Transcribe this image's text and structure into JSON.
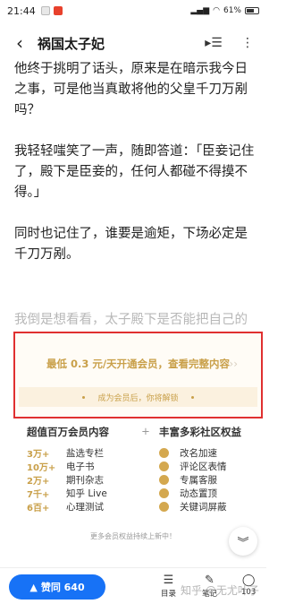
{
  "status_bar": {
    "time": "21:44",
    "battery": "61%"
  },
  "header": {
    "title": "祸国太子妃"
  },
  "article": {
    "paragraphs": [
      "他终于挑明了话头，原来是在暗示我今日之事，可是他当真敢将他的父皇千刀万剐吗？",
      "我轻轻嗤笑了一声，随即答道：「臣妾记住了，殿下是臣妾的，任何人都碰不得摸不得。」",
      "同时也记住了，谁要是逾矩，下场必定是千刀万剐。"
    ],
    "faded_text": "我倒是想看看，太子殿下是否能把自己的"
  },
  "paywall": {
    "cta": "最低 0.3 元/天开通会员，查看完整内容",
    "unlock_hint": "成为会员后，你将解锁"
  },
  "benefits": {
    "left_title": "超值百万会员内容",
    "plus": "+",
    "right_title": "丰富多彩社区权益",
    "left_items": [
      {
        "count": "3万+",
        "label": "盐选专栏"
      },
      {
        "count": "10万+",
        "label": "电子书"
      },
      {
        "count": "2万+",
        "label": "期刊杂志"
      },
      {
        "count": "7千+",
        "label": "知乎 Live"
      },
      {
        "count": "6百+",
        "label": "心理测试"
      }
    ],
    "right_items": [
      {
        "label": "改名加速"
      },
      {
        "label": "评论区表情"
      },
      {
        "label": "专属客服"
      },
      {
        "label": "动态置顶"
      },
      {
        "label": "关键词屏蔽"
      }
    ],
    "more": "更多会员权益持续上新中！"
  },
  "bottom_bar": {
    "vote": "赞同 640",
    "toc": "目录",
    "notes": "笔记",
    "comments_count": "103"
  },
  "watermark": "知乎 @无尤叶子"
}
